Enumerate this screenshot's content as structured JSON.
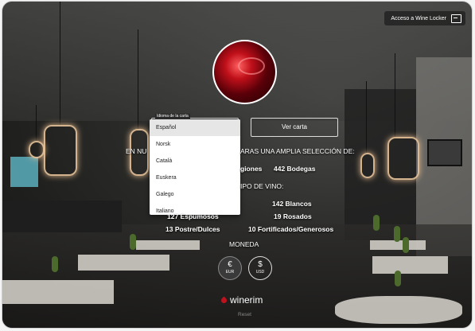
{
  "top_button": {
    "label": "Acceso a Wine Locker",
    "icon": "logout-icon"
  },
  "language_select": {
    "label": "Idioma de la carta",
    "options": [
      "Español",
      "Norsk",
      "Català",
      "Euskera",
      "Galego",
      "Italiano"
    ],
    "selected": "Español"
  },
  "view_button": {
    "label": "Ver carta"
  },
  "summary": {
    "intro_left": "EN NU",
    "intro_right": "ARAS UNA AMPLIA SELECCIÓN DE:",
    "regiones": "giones",
    "bodegas": "442 Bodegas",
    "tipo": "IPO DE VINO:",
    "blancos": "142 Blancos",
    "espumosos": "127 Espumosos",
    "rosados": "19 Rosados",
    "postre": "13 Postre/Dulces",
    "fortificados": "10 Fortificados/Generosos"
  },
  "currency": {
    "label": "MONEDA",
    "options": [
      {
        "symbol": "€",
        "code": "EUR",
        "active": true
      },
      {
        "symbol": "$",
        "code": "USD",
        "active": false
      }
    ]
  },
  "brand": {
    "name": "winerim",
    "color": "#c0121e"
  },
  "reset_label": "Reset"
}
